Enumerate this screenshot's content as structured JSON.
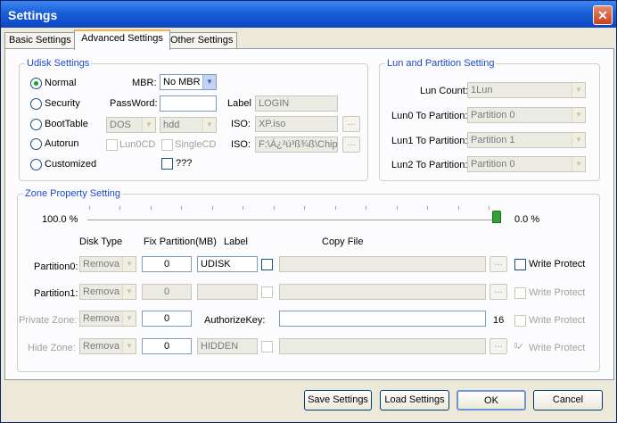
{
  "window": {
    "title": "Settings"
  },
  "tabs": [
    "Basic Settings",
    "Advanced Settings",
    "Other Settings"
  ],
  "udisk": {
    "legend": "Udisk Settings",
    "modes": [
      "Normal",
      "Security",
      "BootTable",
      "Autorun",
      "Customized"
    ],
    "selected_mode": "Normal",
    "mbr_label": "MBR:",
    "mbr_value": "No MBR",
    "password_label": "PassWord:",
    "password_value": "",
    "label_label": "Label",
    "label_value": "LOGIN",
    "boot_combo1": "DOS",
    "boot_combo2": "hdd",
    "iso_label": "ISO:",
    "iso1_value": "XP.iso",
    "lun0cd": "Lun0CD",
    "singlecd": "SingleCD",
    "iso2_value": "F:\\Á¿²ú³ß¾ß\\Chip",
    "unknown_check": "???",
    "browse": "..."
  },
  "lun": {
    "legend": "Lun and Partition Setting",
    "rows": [
      {
        "label": "Lun Count:",
        "value": "1Lun"
      },
      {
        "label": "Lun0 To Partition:",
        "value": "Partition 0"
      },
      {
        "label": "Lun1 To Partition:",
        "value": "Partition 1"
      },
      {
        "label": "Lun2 To Partition:",
        "value": "Partition 0"
      }
    ]
  },
  "zone": {
    "legend": "Zone Property Setting",
    "left_pct": "100.0 %",
    "right_pct": "0.0 %",
    "slider_position": 1.0,
    "headers": {
      "disk_type": "Disk Type",
      "fix_partition": "Fix Partition(MB)",
      "label": "Label",
      "copy_file": "Copy File"
    },
    "rows": [
      {
        "name": "Partition0:",
        "disk_type": "Remova",
        "fix": "0",
        "label": "UDISK",
        "write_protect": "Write Protect"
      },
      {
        "name": "Partition1:",
        "disk_type": "Remova",
        "fix": "0",
        "label": "",
        "write_protect": "Write Protect"
      },
      {
        "name": "Private Zone:",
        "disk_type": "Remova",
        "fix": "0",
        "authorize_label": "AuthorizeKey:",
        "authorize_value": "",
        "count": "16",
        "write_protect": "Write Protect"
      },
      {
        "name": "Hide Zone:",
        "disk_type": "Remova",
        "fix": "0",
        "label": "HIDDEN",
        "write_protect": "Write Protect"
      }
    ]
  },
  "footer": {
    "save": "Save Settings",
    "load": "Load Settings",
    "ok": "OK",
    "cancel": "Cancel"
  },
  "colors": {
    "title_bar": "#1a5fd8",
    "legend": "#1e48c8",
    "dialog_bg": "#ece9d8",
    "close": "#c8401c"
  }
}
